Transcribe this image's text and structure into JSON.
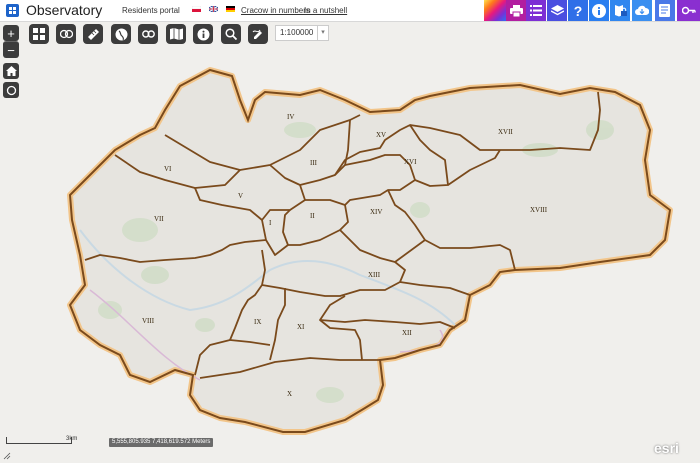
{
  "header": {
    "title": "Observatory",
    "links": [
      "Residents portal",
      "Cracow in numbers",
      "In a nutshell"
    ]
  },
  "languages": [
    "pl",
    "en",
    "de"
  ],
  "toolbar_icons": [
    "printer-icon",
    "list-icon",
    "layers-icon",
    "help-icon",
    "info-icon",
    "lock-map-icon",
    "download-icon",
    "notes-icon",
    "key-icon"
  ],
  "map_tools": [
    "basemap-gallery-icon",
    "analysis-icon",
    "measure-icon",
    "globe-icon",
    "link-icon",
    "map-icon",
    "info-icon",
    "search-icon",
    "draw-icon"
  ],
  "scale": {
    "value": "1:100000"
  },
  "districts": [
    "I",
    "II",
    "III",
    "IV",
    "V",
    "VI",
    "VII",
    "VIII",
    "IX",
    "X",
    "XI",
    "XII",
    "XIII",
    "XIV",
    "XV",
    "XVI",
    "XVII",
    "XVIII"
  ],
  "scalebar": {
    "label": "3km"
  },
  "coordinates": "5,555,805.935 7,418,619.572 Meters",
  "attribution": "esri",
  "colors": {
    "boundary": "#7a4a1c",
    "halo": "#f2c58a",
    "land": "#e6e4df",
    "accent": "#2b6ff2"
  }
}
